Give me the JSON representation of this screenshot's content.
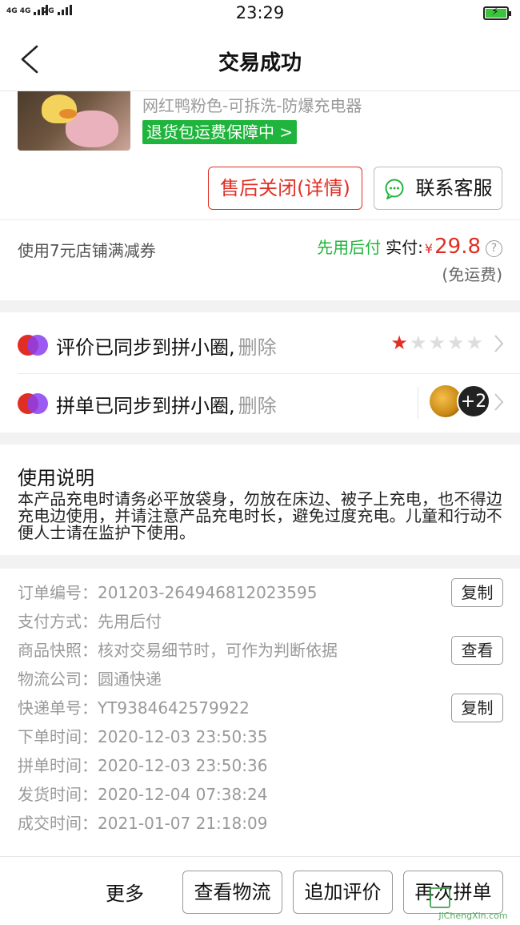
{
  "status_bar": {
    "sim1_label": "4G 4G",
    "sim2_label": "2G",
    "time": "23:29",
    "battery_icon": "battery-charging-icon"
  },
  "nav": {
    "title": "交易成功",
    "back_icon": "chevron-left-icon"
  },
  "product": {
    "title": "网红鸭粉色-可拆洗-防爆充电器",
    "guarantee": "退货包运费保障中 >",
    "after_sale_button": "售后关闭(详情)",
    "customer_service_button": "联系客服",
    "customer_service_icon": "chat-bubble-icon"
  },
  "payment": {
    "coupon": "使用7元店铺满减券",
    "pay_later": "先用后付",
    "paid_label": "实付:",
    "currency": "¥",
    "amount": "29.8",
    "help": "?",
    "shipping": "(免运费)"
  },
  "sync": {
    "review_text": "评价已同步到拼小圈,",
    "review_delete": "删除",
    "rating": 1,
    "rating_max": 5,
    "order_text": "拼单已同步到拼小圈,",
    "order_delete": "删除",
    "extra_count": "+2"
  },
  "instructions": {
    "title": "使用说明",
    "body": "本产品充电时请务必平放袋身，勿放在床边、被子上充电，也不得边充电边使用，并请注意产品充电时长，避免过度充电。儿童和行动不便人士请在监护下使用。"
  },
  "order": {
    "rows": [
      {
        "key": "订单编号：",
        "value": "201203-264946812023595",
        "button": "复制"
      },
      {
        "key": "支付方式：",
        "value": "先用后付"
      },
      {
        "key": "商品快照：",
        "value": "核对交易细节时，可作为判断依据",
        "button": "查看"
      },
      {
        "key": "物流公司：",
        "value": "圆通快递"
      },
      {
        "key": "快递单号：",
        "value": "YT9384642579922",
        "button": "复制"
      },
      {
        "key": "下单时间：",
        "value": "2020-12-03 23:50:35"
      },
      {
        "key": "拼单时间：",
        "value": "2020-12-03 23:50:36"
      },
      {
        "key": "发货时间：",
        "value": "2020-12-04 07:38:24"
      },
      {
        "key": "成交时间：",
        "value": "2021-01-07 21:18:09"
      }
    ]
  },
  "bottom_bar": {
    "more": "更多",
    "logistics": "查看物流",
    "add_review": "追加评价",
    "regroup": "再次拼单"
  },
  "watermark": {
    "text": "JiChengXin.com"
  },
  "colors": {
    "accent_red": "#e02e24",
    "green": "#1fb53c",
    "gray_text": "#999999",
    "section_gap": "#f2f2f2"
  }
}
